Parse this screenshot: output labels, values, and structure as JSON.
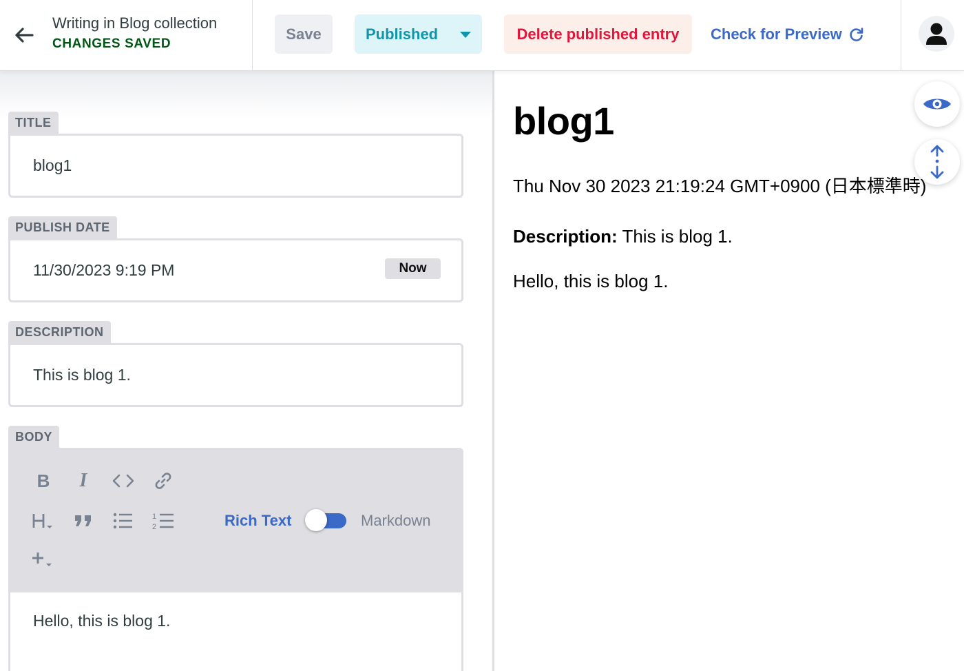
{
  "header": {
    "collection_title": "Writing in Blog collection",
    "status": "CHANGES SAVED",
    "save_label": "Save",
    "publish_label": "Published",
    "delete_label": "Delete published entry",
    "preview_label": "Check for Preview"
  },
  "fields": {
    "title": {
      "label": "TITLE",
      "value": "blog1"
    },
    "publish_date": {
      "label": "PUBLISH DATE",
      "value": "11/30/2023 9:19 PM",
      "now_label": "Now"
    },
    "description": {
      "label": "DESCRIPTION",
      "value": "This is blog 1."
    },
    "body": {
      "label": "BODY",
      "mode_rich": "Rich Text",
      "mode_markdown": "Markdown",
      "toggle_on": true,
      "content": "Hello, this is blog 1."
    }
  },
  "toolbar": {
    "icons": [
      "bold-icon",
      "italic-icon",
      "code-icon",
      "link-icon",
      "heading-icon",
      "quote-icon",
      "bulleted-list-icon",
      "numbered-list-icon",
      "add-component-icon"
    ]
  },
  "preview": {
    "title": "blog1",
    "date": "Thu Nov 30 2023 21:19:24 GMT+0900 (日本標準時)",
    "description_label": "Description:",
    "description_value": "This is blog 1.",
    "body": "Hello, this is blog 1."
  },
  "colors": {
    "status_green": "#005614",
    "publish_teal": "#1195aa",
    "delete_red": "#e0163b",
    "link_blue": "#3a69c7"
  }
}
